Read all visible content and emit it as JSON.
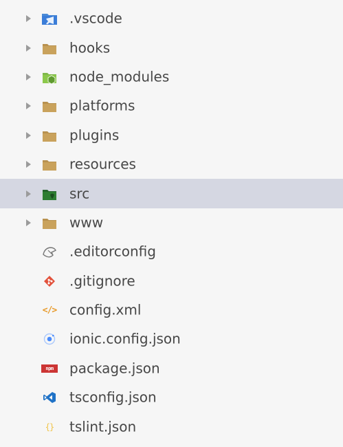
{
  "explorer": {
    "items": [
      {
        "label": ".vscode",
        "kind": "folder",
        "icon": "vscode-folder-icon",
        "color": "#3b7dd8"
      },
      {
        "label": "hooks",
        "kind": "folder",
        "icon": "folder-icon",
        "color": "#c9a25c"
      },
      {
        "label": "node_modules",
        "kind": "folder",
        "icon": "node-folder-icon",
        "color": "#8cc84b"
      },
      {
        "label": "platforms",
        "kind": "folder",
        "icon": "folder-icon",
        "color": "#c9a25c"
      },
      {
        "label": "plugins",
        "kind": "folder",
        "icon": "folder-icon",
        "color": "#c9a25c"
      },
      {
        "label": "resources",
        "kind": "folder",
        "icon": "folder-icon",
        "color": "#c9a25c"
      },
      {
        "label": "src",
        "kind": "folder",
        "icon": "src-folder-icon",
        "color": "#2e7d32",
        "selected": true
      },
      {
        "label": "www",
        "kind": "folder",
        "icon": "folder-icon",
        "color": "#c9a25c"
      },
      {
        "label": ".editorconfig",
        "kind": "file",
        "icon": "editorconfig-icon",
        "color": "#777777"
      },
      {
        "label": ".gitignore",
        "kind": "file",
        "icon": "git-icon",
        "color": "#e2513b"
      },
      {
        "label": "config.xml",
        "kind": "file",
        "icon": "xml-icon",
        "color": "#e89b2c"
      },
      {
        "label": "ionic.config.json",
        "kind": "file",
        "icon": "ionic-icon",
        "color": "#4a8bfc"
      },
      {
        "label": "package.json",
        "kind": "file",
        "icon": "npm-icon",
        "color": "#cc3534",
        "badge": "npm"
      },
      {
        "label": "tsconfig.json",
        "kind": "file",
        "icon": "vscode-icon",
        "color": "#1f72c7"
      },
      {
        "label": "tslint.json",
        "kind": "file",
        "icon": "json-icon",
        "color": "#f0c44a"
      }
    ]
  }
}
